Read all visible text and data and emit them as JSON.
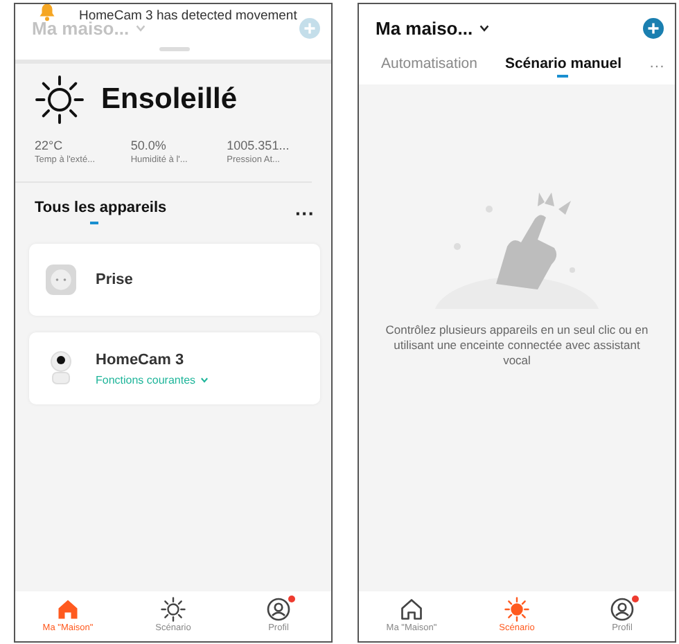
{
  "screens": [
    {
      "kind": "home",
      "header": {
        "title": "Ma maiso..."
      },
      "notification": {
        "text": "HomeCam 3 has detected movement"
      },
      "weather": {
        "condition": "Ensoleillé",
        "stats": [
          {
            "value": "22°C",
            "label": "Temp à l'exté..."
          },
          {
            "value": "50.0%",
            "label": "Humidité à l'..."
          },
          {
            "value": "1005.351...",
            "label": "Pression At..."
          }
        ]
      },
      "section": {
        "title": "Tous les appareils",
        "more": "···"
      },
      "devices": [
        {
          "kind": "plug",
          "name": "Prise"
        },
        {
          "kind": "camera",
          "name": "HomeCam 3",
          "action": "Fonctions courantes"
        }
      ],
      "nav": [
        {
          "kind": "home",
          "label": "Ma \"Maison\"",
          "selected": true,
          "badge": false
        },
        {
          "kind": "sun",
          "label": "Scénario",
          "selected": false,
          "badge": false
        },
        {
          "kind": "profile",
          "label": "Profil",
          "selected": false,
          "badge": true
        }
      ]
    },
    {
      "kind": "scenes",
      "header": {
        "title": "Ma maiso..."
      },
      "tabs": [
        {
          "label": "Automatisation",
          "selected": false
        },
        {
          "label": "Scénario manuel",
          "selected": true
        }
      ],
      "more": "···",
      "empty_text": "Contrôlez plusieurs appareils en un seul clic ou en utilisant une enceinte connectée avec assistant vocal",
      "nav": [
        {
          "kind": "home",
          "label": "Ma \"Maison\"",
          "selected": false,
          "badge": false
        },
        {
          "kind": "sun",
          "label": "Scénario",
          "selected": true,
          "badge": false
        },
        {
          "kind": "profile",
          "label": "Profil",
          "selected": false,
          "badge": true
        }
      ]
    }
  ]
}
